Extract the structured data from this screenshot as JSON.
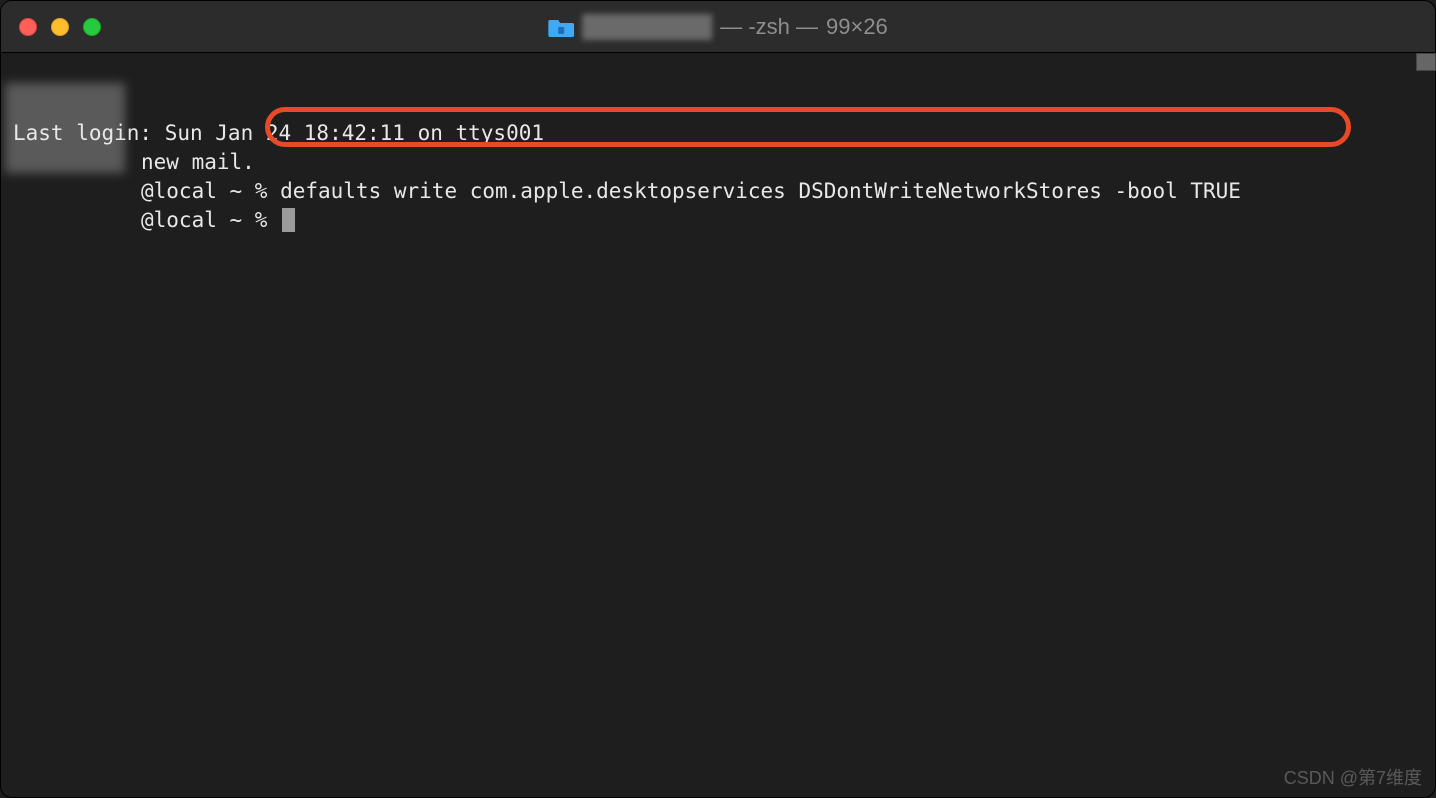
{
  "window": {
    "title_shell": "— -zsh —",
    "title_dims": "99×26"
  },
  "terminal": {
    "line1": "Last login: Sun Jan 24 18:42:11 on ttys001",
    "line2_text": "new mail.",
    "prompt_suffix": "@local ~ % ",
    "command": "defaults write com.apple.desktopservices DSDontWriteNetworkStores -bool TRUE"
  },
  "annotation": {
    "highlight_color": "#e84a27"
  },
  "watermark": "CSDN @第7维度"
}
